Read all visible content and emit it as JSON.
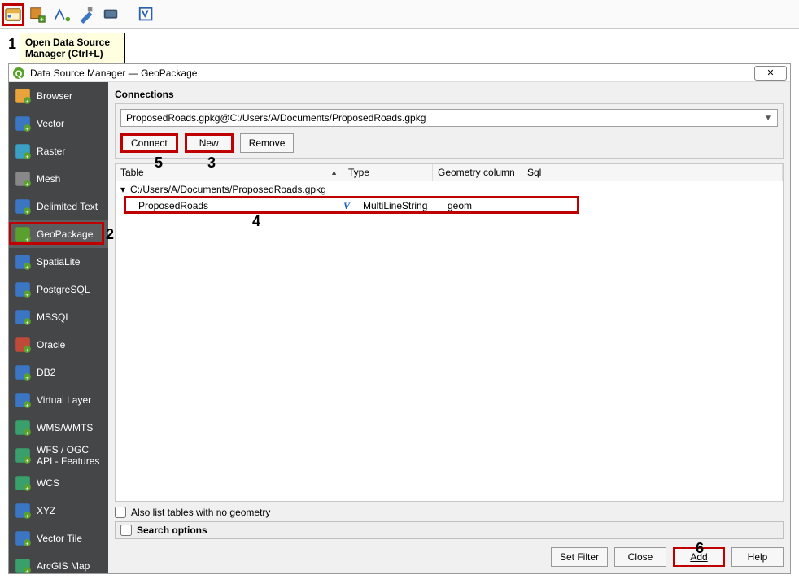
{
  "toolbar_top": {
    "icons": [
      "data-source-manager-icon",
      "new-geopackage-icon",
      "new-vector-layer-icon",
      "edit-layer-icon",
      "new-raster-layer-icon",
      "new-virtual-layer-icon"
    ]
  },
  "tooltip": {
    "text": "Open Data Source Manager (Ctrl+L)"
  },
  "dialog": {
    "title": "Data Source Manager — GeoPackage"
  },
  "sidebar": {
    "items": [
      {
        "label": "Browser",
        "icon": "folder-icon"
      },
      {
        "label": "Vector",
        "icon": "vector-icon"
      },
      {
        "label": "Raster",
        "icon": "raster-icon"
      },
      {
        "label": "Mesh",
        "icon": "mesh-icon"
      },
      {
        "label": "Delimited Text",
        "icon": "delimited-text-icon"
      },
      {
        "label": "GeoPackage",
        "icon": "geopackage-icon",
        "selected": true
      },
      {
        "label": "SpatiaLite",
        "icon": "spatialite-icon"
      },
      {
        "label": "PostgreSQL",
        "icon": "postgresql-icon"
      },
      {
        "label": "MSSQL",
        "icon": "mssql-icon"
      },
      {
        "label": "Oracle",
        "icon": "oracle-icon"
      },
      {
        "label": "DB2",
        "icon": "db2-icon"
      },
      {
        "label": "Virtual Layer",
        "icon": "virtual-layer-icon"
      },
      {
        "label": "WMS/WMTS",
        "icon": "wms-icon"
      },
      {
        "label": "WFS / OGC API - Features",
        "icon": "wfs-icon"
      },
      {
        "label": "WCS",
        "icon": "wcs-icon"
      },
      {
        "label": "XYZ",
        "icon": "xyz-icon"
      },
      {
        "label": "Vector Tile",
        "icon": "vector-tile-icon"
      },
      {
        "label": "ArcGIS Map",
        "icon": "arcgis-icon"
      }
    ]
  },
  "connections": {
    "group_label": "Connections",
    "selected": "ProposedRoads.gpkg@C:/Users/A/Documents/ProposedRoads.gpkg",
    "buttons": {
      "connect": "Connect",
      "new": "New",
      "remove": "Remove"
    }
  },
  "table": {
    "headers": {
      "table": "Table",
      "type": "Type",
      "geom": "Geometry column",
      "sql": "Sql"
    },
    "root_path": "C:/Users/A/Documents/ProposedRoads.gpkg",
    "rows": [
      {
        "name": "ProposedRoads",
        "type": "MultiLineString",
        "geom": "geom",
        "sql": ""
      }
    ]
  },
  "options": {
    "also_list": "Also list tables with no geometry",
    "search_options": "Search options"
  },
  "bottom": {
    "set_filter": "Set Filter",
    "close": "Close",
    "add": "Add",
    "help": "Help"
  },
  "callouts": {
    "1": "1",
    "2": "2",
    "3": "3",
    "4": "4",
    "5": "5",
    "6": "6"
  }
}
